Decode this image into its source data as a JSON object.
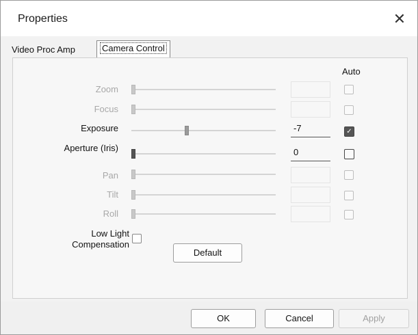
{
  "window": {
    "title": "Properties",
    "close_glyph": "✕"
  },
  "tabs": [
    {
      "label": "Video Proc Amp",
      "active": false
    },
    {
      "label": "Camera Control",
      "active": true
    }
  ],
  "auto_header": "Auto",
  "controls": [
    {
      "label": "Zoom",
      "enabled": false,
      "value": "",
      "auto": false,
      "level": 0.0
    },
    {
      "label": "Focus",
      "enabled": false,
      "value": "",
      "auto": false,
      "level": 0.0
    },
    {
      "label": "Exposure",
      "enabled": true,
      "value": "-7",
      "auto": true,
      "level": 0.38
    },
    {
      "label": "Aperture (Iris)",
      "enabled": true,
      "value": "0",
      "auto": false,
      "level": 0.0
    },
    {
      "label": "Pan",
      "enabled": false,
      "value": "",
      "auto": false,
      "level": 0.0
    },
    {
      "label": "Tilt",
      "enabled": false,
      "value": "",
      "auto": false,
      "level": 0.0
    },
    {
      "label": "Roll",
      "enabled": false,
      "value": "",
      "auto": false,
      "level": 0.0
    }
  ],
  "low_light": {
    "label_line1": "Low Light",
    "label_line2": "Compensation",
    "checked": false
  },
  "buttons": {
    "default": "Default",
    "ok": "OK",
    "cancel": "Cancel",
    "apply": "Apply"
  },
  "colors": {
    "checkbox_checked": "#555555",
    "disabled_text": "#a8a8a8"
  }
}
